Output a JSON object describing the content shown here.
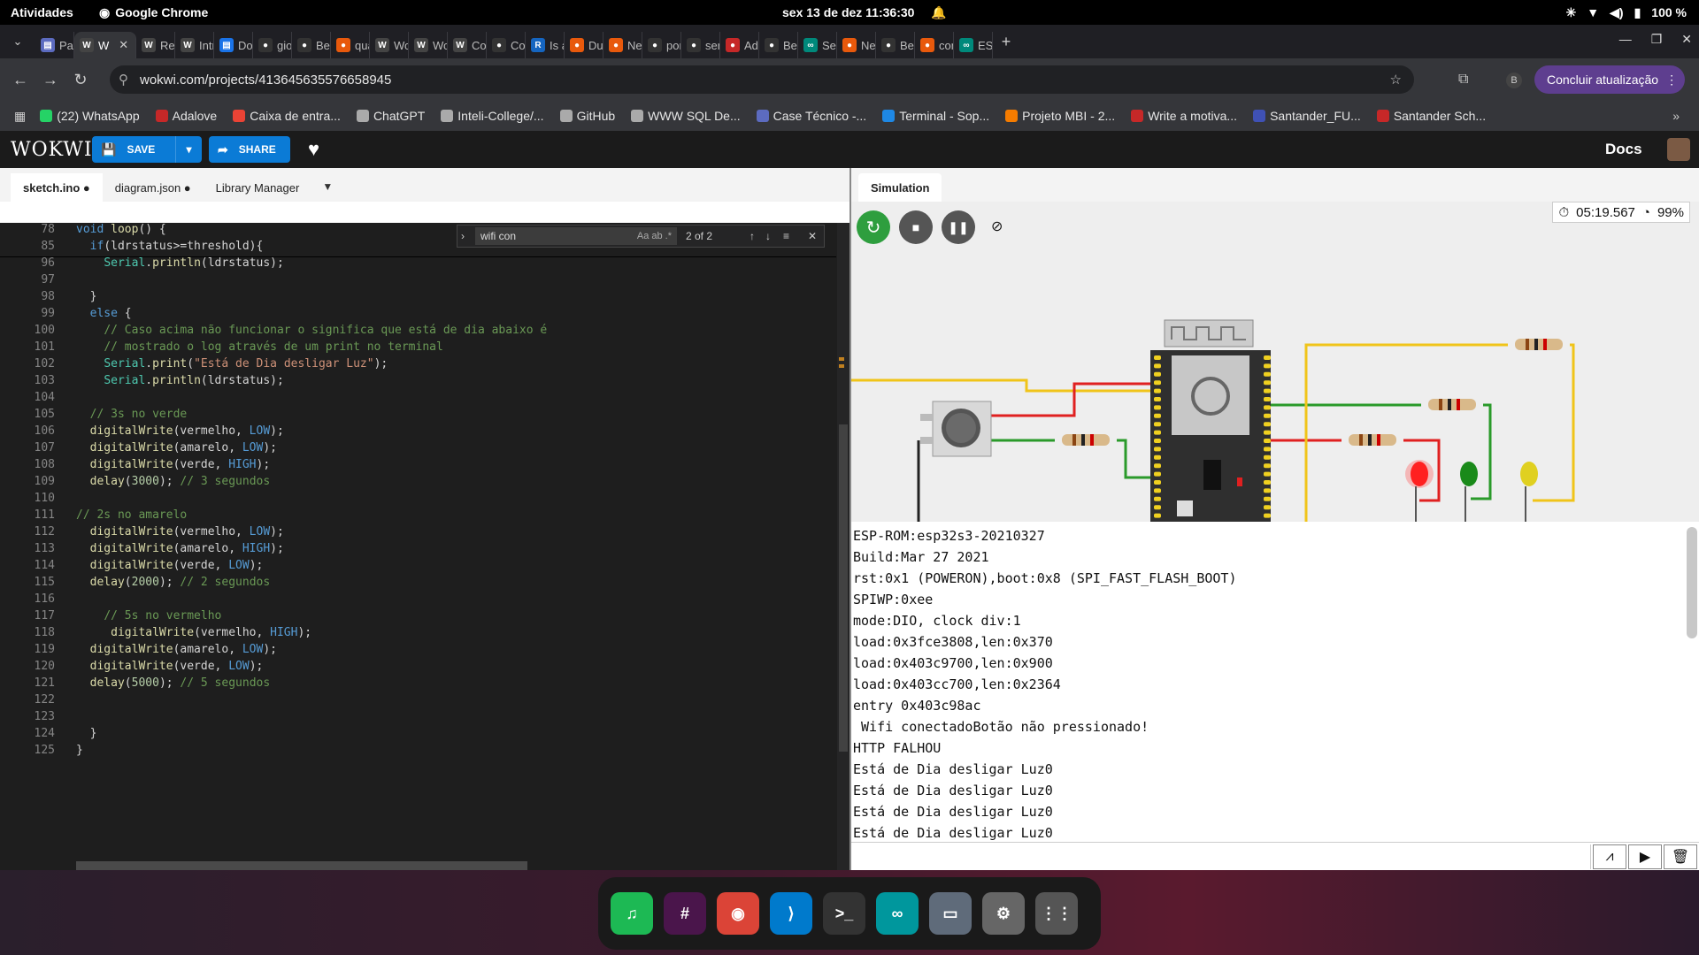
{
  "topbar": {
    "activities": "Atividades",
    "app": "Google Chrome",
    "clock": "sex 13 de dez  11:36:30",
    "battery": "100 %"
  },
  "tabs": [
    {
      "label": "Par",
      "color": "#5c6bc0",
      "glyph": "▤"
    },
    {
      "label": "W",
      "color": "#444",
      "glyph": "W",
      "active": true
    },
    {
      "label": "Rec",
      "color": "#444",
      "glyph": "W"
    },
    {
      "label": "Intr",
      "color": "#444",
      "glyph": "W"
    },
    {
      "label": "Doc",
      "color": "#1a73e8",
      "glyph": "▤"
    },
    {
      "label": "gio",
      "color": "#333",
      "glyph": "●"
    },
    {
      "label": "Ber",
      "color": "#333",
      "glyph": "●"
    },
    {
      "label": "qua",
      "color": "#e8590c",
      "glyph": "●"
    },
    {
      "label": "Wo",
      "color": "#444",
      "glyph": "W"
    },
    {
      "label": "Wo",
      "color": "#444",
      "glyph": "W"
    },
    {
      "label": "Cor",
      "color": "#444",
      "glyph": "W"
    },
    {
      "label": "Cor",
      "color": "#333",
      "glyph": "●"
    },
    {
      "label": "Is a",
      "color": "#1565c0",
      "glyph": "R"
    },
    {
      "label": "Duc",
      "color": "#e8590c",
      "glyph": "●"
    },
    {
      "label": "Nev",
      "color": "#e8590c",
      "glyph": "●"
    },
    {
      "label": "por",
      "color": "#333",
      "glyph": "●"
    },
    {
      "label": "sen",
      "color": "#333",
      "glyph": "●"
    },
    {
      "label": "Ada",
      "color": "#c62828",
      "glyph": "●"
    },
    {
      "label": "Ber",
      "color": "#333",
      "glyph": "●"
    },
    {
      "label": "Ser",
      "color": "#00897b",
      "glyph": "∞"
    },
    {
      "label": "Nev",
      "color": "#e8590c",
      "glyph": "●"
    },
    {
      "label": "Ber",
      "color": "#333",
      "glyph": "●"
    },
    {
      "label": "con",
      "color": "#e8590c",
      "glyph": "●"
    },
    {
      "label": "ESP",
      "color": "#00897b",
      "glyph": "∞"
    }
  ],
  "address": {
    "url": "wokwi.com/projects/413645635576658945",
    "update_label": "Concluir atualização",
    "profile": "B"
  },
  "bookmarks": [
    {
      "label": "(22) WhatsApp",
      "color": "#25d366"
    },
    {
      "label": "Adalove",
      "color": "#c62828"
    },
    {
      "label": "Caixa de entra...",
      "color": "#ea4335"
    },
    {
      "label": "ChatGPT",
      "color": "#aaa"
    },
    {
      "label": "Inteli-College/...",
      "color": "#aaa"
    },
    {
      "label": "GitHub",
      "color": "#aaa"
    },
    {
      "label": "WWW SQL De...",
      "color": "#aaa"
    },
    {
      "label": "Case Técnico -...",
      "color": "#5c6bc0"
    },
    {
      "label": "Terminal - Sop...",
      "color": "#1e88e5"
    },
    {
      "label": "Projeto MBI - 2...",
      "color": "#f57c00"
    },
    {
      "label": "Write a motiva...",
      "color": "#c62828"
    },
    {
      "label": "Santander_FU...",
      "color": "#3f51b5"
    },
    {
      "label": "Santander Sch...",
      "color": "#c62828"
    }
  ],
  "wokwi": {
    "logo": "WOKWI",
    "save": "SAVE",
    "share": "SHARE",
    "docs": "Docs"
  },
  "editor": {
    "tabs": [
      {
        "label": "sketch.ino ●",
        "active": true
      },
      {
        "label": "diagram.json ●"
      },
      {
        "label": "Library Manager"
      }
    ],
    "find": {
      "query": "wifi con",
      "count": "2 of 2",
      "opts": "Aa  ab  .*"
    }
  },
  "code_lines": [
    {
      "n": "78",
      "t": "void loop() {"
    },
    {
      "n": "85",
      "t": "  if(ldrstatus>=threshold){"
    },
    {
      "n": "96",
      "t": "    Serial.println(ldrstatus);"
    },
    {
      "n": "97",
      "t": ""
    },
    {
      "n": "98",
      "t": "  }"
    },
    {
      "n": "99",
      "t": "  else {"
    },
    {
      "n": "100",
      "t": "    // Caso acima não funcionar o significa que está de dia abaixo é"
    },
    {
      "n": "101",
      "t": "    // mostrado o log através de um print no terminal"
    },
    {
      "n": "102",
      "t": "    Serial.print(\"Está de Dia desligar Luz\");"
    },
    {
      "n": "103",
      "t": "    Serial.println(ldrstatus);"
    },
    {
      "n": "104",
      "t": ""
    },
    {
      "n": "105",
      "t": "  // 3s no verde"
    },
    {
      "n": "106",
      "t": "  digitalWrite(vermelho, LOW);"
    },
    {
      "n": "107",
      "t": "  digitalWrite(amarelo, LOW);"
    },
    {
      "n": "108",
      "t": "  digitalWrite(verde, HIGH);"
    },
    {
      "n": "109",
      "t": "  delay(3000); // 3 segundos"
    },
    {
      "n": "110",
      "t": ""
    },
    {
      "n": "111",
      "t": "// 2s no amarelo"
    },
    {
      "n": "112",
      "t": "  digitalWrite(vermelho, LOW);"
    },
    {
      "n": "113",
      "t": "  digitalWrite(amarelo, HIGH);"
    },
    {
      "n": "114",
      "t": "  digitalWrite(verde, LOW);"
    },
    {
      "n": "115",
      "t": "  delay(2000); // 2 segundos"
    },
    {
      "n": "116",
      "t": ""
    },
    {
      "n": "117",
      "t": "    // 5s no vermelho"
    },
    {
      "n": "118",
      "t": "     digitalWrite(vermelho, HIGH);"
    },
    {
      "n": "119",
      "t": "  digitalWrite(amarelo, LOW);"
    },
    {
      "n": "120",
      "t": "  digitalWrite(verde, LOW);"
    },
    {
      "n": "121",
      "t": "  delay(5000); // 5 segundos"
    },
    {
      "n": "122",
      "t": ""
    },
    {
      "n": "123",
      "t": ""
    },
    {
      "n": "124",
      "t": "  }"
    },
    {
      "n": "125",
      "t": "}"
    }
  ],
  "simulation": {
    "tab": "Simulation",
    "timer": "05:19.567",
    "speed": "99%"
  },
  "serial_lines": [
    "ESP-ROM:esp32s3-20210327",
    "Build:Mar 27 2021",
    "rst:0x1 (POWERON),boot:0x8 (SPI_FAST_FLASH_BOOT)",
    "SPIWP:0xee",
    "mode:DIO, clock div:1",
    "load:0x3fce3808,len:0x370",
    "load:0x403c9700,len:0x900",
    "load:0x403cc700,len:0x2364",
    "entry 0x403c98ac",
    " Wifi conectadoBotão não pressionado!",
    "HTTP FALHOU",
    "Está de Dia desligar Luz0",
    "Está de Dia desligar Luz0",
    "Está de Dia desligar Luz0",
    "Está de Dia desligar Luz0"
  ],
  "dock": [
    {
      "name": "spotify",
      "color": "#1db954",
      "glyph": "♫"
    },
    {
      "name": "slack",
      "color": "#4a154b",
      "glyph": "#"
    },
    {
      "name": "chrome",
      "color": "#db4437",
      "glyph": "◉"
    },
    {
      "name": "vscode",
      "color": "#007acc",
      "glyph": "⟩"
    },
    {
      "name": "terminal",
      "color": "#333",
      "glyph": ">_"
    },
    {
      "name": "arduino",
      "color": "#00979d",
      "glyph": "∞"
    },
    {
      "name": "files",
      "color": "#5f6b7a",
      "glyph": "▭"
    },
    {
      "name": "settings",
      "color": "#666",
      "glyph": "⚙"
    },
    {
      "name": "apps",
      "color": "#555",
      "glyph": "⋮⋮"
    }
  ]
}
